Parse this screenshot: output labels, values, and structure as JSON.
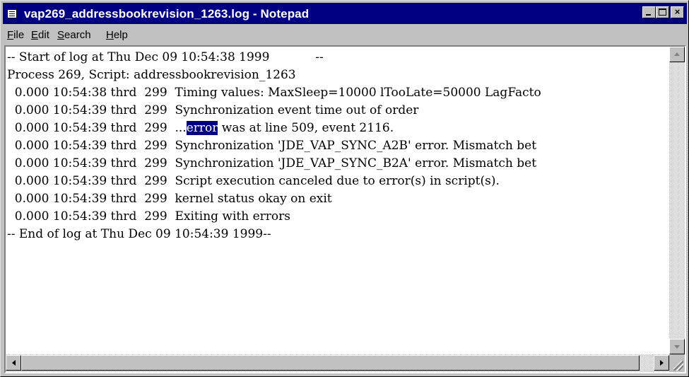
{
  "window": {
    "title": "vap269_addressbookrevision_1263.log - Notepad",
    "title_bar_color": "#000080"
  },
  "title_buttons": {
    "minimize_icon": "minimize-icon",
    "maximize_icon": "maximize-icon",
    "close_label": "×"
  },
  "menu": {
    "items": [
      {
        "key": "F",
        "rest": "ile"
      },
      {
        "key": "E",
        "rest": "dit"
      },
      {
        "key": "S",
        "rest": "earch"
      },
      {
        "key": "H",
        "rest": "elp"
      }
    ]
  },
  "log": {
    "lines": [
      "-- Start of log at Thu Dec 09 10:54:38 1999            --",
      "Process 269, Script: addressbookrevision_1263",
      "  0.000 10:54:38 thrd  299  Timing values: MaxSleep=10000 lTooLate=50000 LagFacto",
      "  0.000 10:54:39 thrd  299  Synchronization event time out of order",
      "  0.000 10:54:39 thrd  299  ...",
      "  0.000 10:54:39 thrd  299  Synchronization 'JDE_VAP_SYNC_A2B' error. Mismatch bet",
      "  0.000 10:54:39 thrd  299  Synchronization 'JDE_VAP_SYNC_B2A' error. Mismatch bet",
      "  0.000 10:54:39 thrd  299  Script execution canceled due to error(s) in script(s).",
      "  0.000 10:54:39 thrd  299  kernel status okay on exit",
      "  0.000 10:54:39 thrd  299  Exiting with errors",
      "-- End of log at Thu Dec 09 10:54:39 1999--"
    ],
    "selected_word": "error",
    "after_selection": " was at line 509, event 2116.",
    "selection_color": "#000080"
  }
}
